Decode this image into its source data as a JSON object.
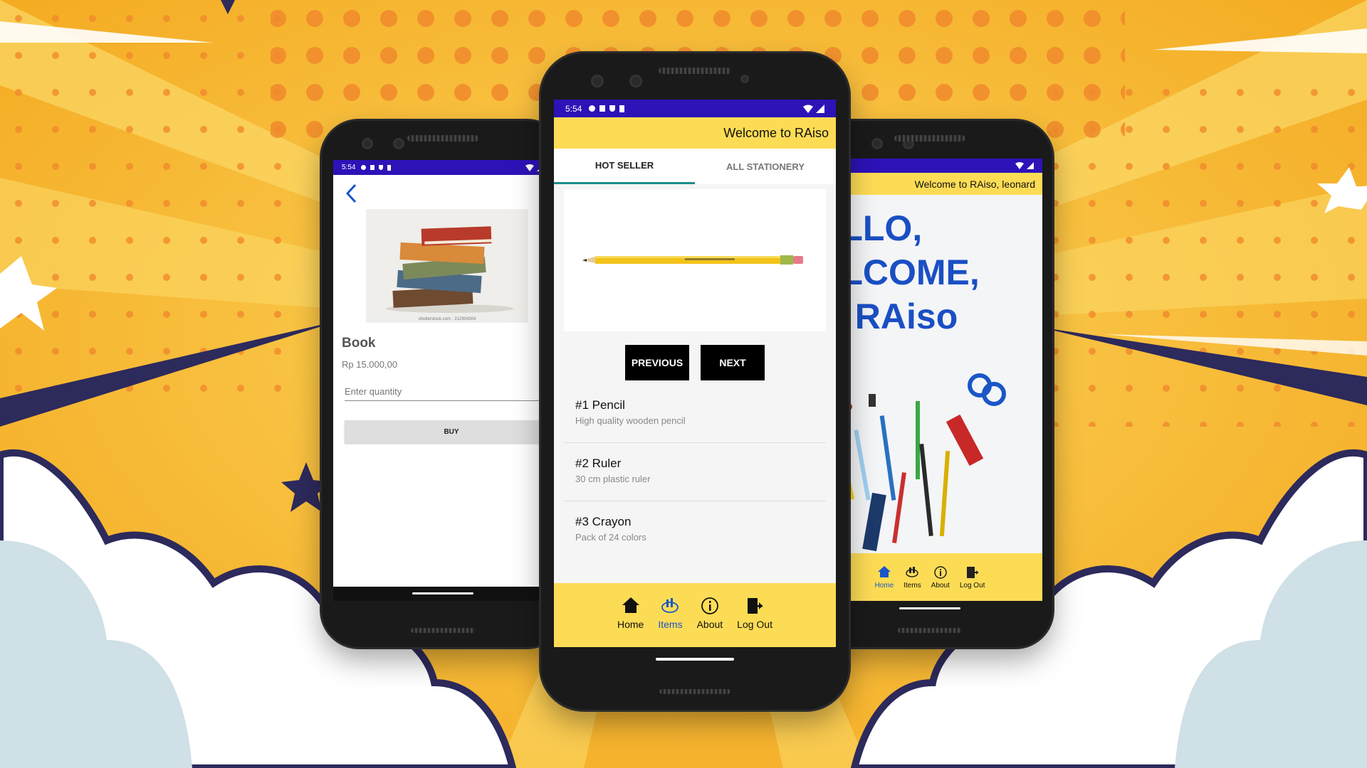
{
  "colors": {
    "background": "#f6b92a",
    "status_bar": "#2d12b8",
    "app_accent": "#fddc55",
    "active_nav": "#1a56c8",
    "tab_indicator": "#1e8c8c",
    "hello_text": "#1a4fc4"
  },
  "left_phone": {
    "status": {
      "time": "5:54"
    },
    "back_icon": "chevron-left-icon",
    "product": {
      "image_caption": "shutterstock.com · 212904304",
      "name": "Book",
      "price": "Rp 15.000,00"
    },
    "quantity": {
      "placeholder": "Enter quantity"
    },
    "buy_label": "BUY"
  },
  "center_phone": {
    "status": {
      "time": "5:54"
    },
    "appbar_title": "Welcome to RAiso",
    "tabs": [
      {
        "label": "HOT SELLER",
        "active": true
      },
      {
        "label": "ALL STATIONERY",
        "active": false
      }
    ],
    "carousel": {
      "previous_label": "PREVIOUS",
      "next_label": "NEXT"
    },
    "items": [
      {
        "title": "#1 Pencil",
        "subtitle": "High quality wooden pencil"
      },
      {
        "title": "#2 Ruler",
        "subtitle": "30 cm plastic ruler"
      },
      {
        "title": "#3 Crayon",
        "subtitle": "Pack of 24 colors"
      }
    ],
    "bottom_nav": [
      {
        "label": "Home",
        "icon": "home-icon",
        "active": false
      },
      {
        "label": "Items",
        "icon": "items-icon",
        "active": true
      },
      {
        "label": "About",
        "icon": "info-icon",
        "active": false
      },
      {
        "label": "Log Out",
        "icon": "logout-icon",
        "active": false
      }
    ]
  },
  "right_phone": {
    "appbar_title": "Welcome to RAiso, leonard",
    "hero": {
      "line1": "ELLO,",
      "line2": "ELCOME,",
      "line3": "O RAiso"
    },
    "bottom_nav": [
      {
        "label": "Home",
        "icon": "home-icon",
        "active": true
      },
      {
        "label": "Items",
        "icon": "items-icon",
        "active": false
      },
      {
        "label": "About",
        "icon": "info-icon",
        "active": false
      },
      {
        "label": "Log Out",
        "icon": "logout-icon",
        "active": false
      }
    ]
  }
}
